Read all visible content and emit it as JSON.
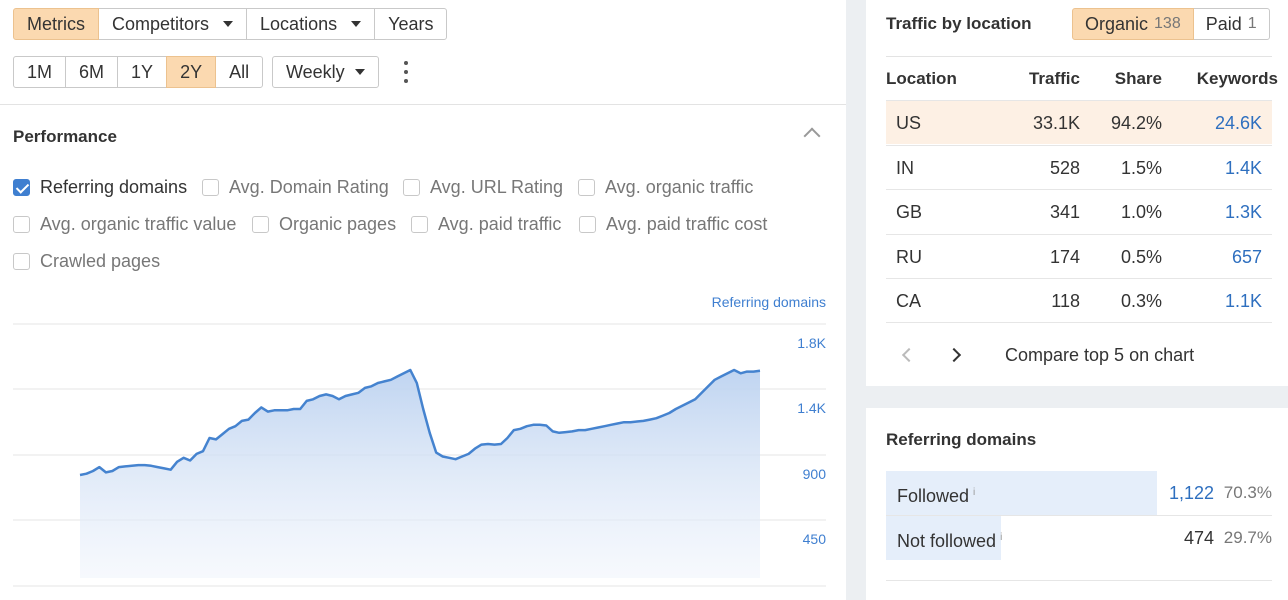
{
  "toolbar": {
    "tabs": [
      {
        "label": "Metrics",
        "active": true
      },
      {
        "label": "Competitors",
        "dropdown": true
      },
      {
        "label": "Locations",
        "dropdown": true
      },
      {
        "label": "Years"
      }
    ],
    "ranges": [
      {
        "label": "1M"
      },
      {
        "label": "6M"
      },
      {
        "label": "1Y"
      },
      {
        "label": "2Y",
        "active": true
      },
      {
        "label": "All"
      }
    ],
    "interval": "Weekly",
    "more_icon": "kebab-icon"
  },
  "performance": {
    "title": "Performance",
    "collapse_icon": "chevron-up-icon",
    "metrics": [
      {
        "label": "Referring domains",
        "checked": true
      },
      {
        "label": "Avg. Domain Rating",
        "checked": false
      },
      {
        "label": "Avg. URL Rating",
        "checked": false
      },
      {
        "label": "Avg. organic traffic",
        "checked": false
      },
      {
        "label": "Avg. organic traffic value",
        "checked": false
      },
      {
        "label": "Organic pages",
        "checked": false
      },
      {
        "label": "Avg. paid traffic",
        "checked": false
      },
      {
        "label": "Avg. paid traffic cost",
        "checked": false
      },
      {
        "label": "Crawled pages",
        "checked": false
      }
    ]
  },
  "chart_data": {
    "type": "area",
    "series": [
      {
        "name": "Referring domains",
        "values": [
          900,
          910,
          930,
          960,
          920,
          930,
          960,
          965,
          970,
          975,
          975,
          970,
          960,
          950,
          940,
          1000,
          1030,
          1010,
          1060,
          1080,
          1180,
          1170,
          1210,
          1250,
          1270,
          1310,
          1320,
          1370,
          1410,
          1380,
          1390,
          1390,
          1390,
          1400,
          1400,
          1450,
          1460,
          1480,
          1490,
          1480,
          1460,
          1480,
          1490,
          1500,
          1530,
          1540,
          1560,
          1570,
          1580,
          1600,
          1620,
          1640,
          1560,
          1400,
          1220,
          1070,
          1040,
          1030,
          1020,
          1040,
          1060,
          1100,
          1130,
          1135,
          1130,
          1135,
          1180,
          1240,
          1250,
          1270,
          1280,
          1280,
          1275,
          1230,
          1220,
          1225,
          1230,
          1240,
          1240,
          1250,
          1260,
          1270,
          1280,
          1290,
          1300,
          1300,
          1305,
          1310,
          1320,
          1330,
          1350,
          1370,
          1400,
          1420,
          1440,
          1460,
          1500,
          1540,
          1580,
          1600,
          1620,
          1640,
          1620,
          1630,
          1630,
          1635
        ]
      }
    ],
    "y_ticks": [
      "1.8K",
      "1.4K",
      "900",
      "450"
    ],
    "ylim": [
      0,
      1930
    ],
    "grid": true,
    "legend": "top-right"
  },
  "traffic": {
    "title": "Traffic by location",
    "organic_label": "Organic",
    "organic_count": "138",
    "paid_label": "Paid",
    "paid_count": "1",
    "headers": {
      "location": "Location",
      "traffic": "Traffic",
      "share": "Share",
      "keywords": "Keywords"
    },
    "rows": [
      {
        "location": "US",
        "traffic": "33.1K",
        "share": "94.2%",
        "keywords": "24.6K"
      },
      {
        "location": "IN",
        "traffic": "528",
        "share": "1.5%",
        "keywords": "1.4K"
      },
      {
        "location": "GB",
        "traffic": "341",
        "share": "1.0%",
        "keywords": "1.3K"
      },
      {
        "location": "RU",
        "traffic": "174",
        "share": "0.5%",
        "keywords": "657"
      },
      {
        "location": "CA",
        "traffic": "118",
        "share": "0.3%",
        "keywords": "1.1K"
      }
    ],
    "compare_label": "Compare top 5 on chart",
    "prev_icon": "chevron-left-icon",
    "next_icon": "chevron-right-icon"
  },
  "referring": {
    "title": "Referring domains",
    "info_mark": "i",
    "rows": [
      {
        "label": "Followed",
        "value": "1,122",
        "pct": "70.3%",
        "share": 0.703
      },
      {
        "label": "Not followed",
        "value": "474",
        "pct": "29.7%",
        "share": 0.297
      }
    ]
  },
  "colors": {
    "accent": "#3f7fd0",
    "active": "#fbd9b0",
    "highlight_row": "#fdf0e4",
    "link": "#2e6fbf"
  }
}
